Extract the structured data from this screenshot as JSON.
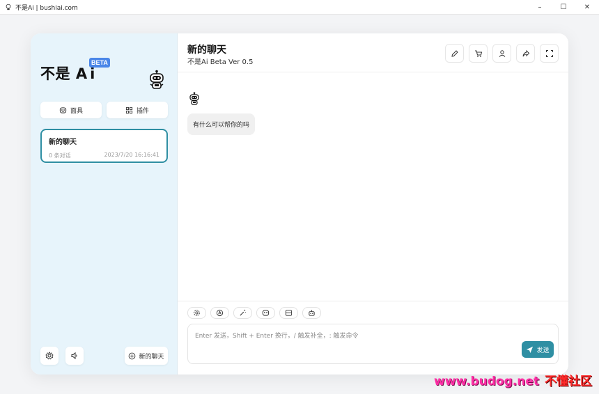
{
  "window": {
    "title": "不是Ai | bushiai.com",
    "controls": [
      "–",
      "☐",
      "✕"
    ]
  },
  "sidebar": {
    "brand": "不是",
    "brand_suffix": "Ai",
    "beta_label": "BETA",
    "mask_button": "面具",
    "plugin_button": "插件",
    "chats": [
      {
        "title": "新的聊天",
        "count": "0 条对话",
        "time": "2023/7/20 16:16:41"
      }
    ],
    "new_chat_button": "新的聊天"
  },
  "header": {
    "title": "新的聊天",
    "subtitle": "不是Ai Beta Ver 0.5"
  },
  "messages": [
    {
      "role": "assistant",
      "text": "有什么可以帮你的吗"
    }
  ],
  "input": {
    "placeholder": "Enter 发送，Shift + Enter 换行，/ 触发补全，: 触发命令",
    "send_label": "发送"
  },
  "watermark": {
    "latin": "www.budog.net",
    "cn": "不懂社区"
  },
  "colors": {
    "accent": "#2f8fa3",
    "sidebar_bg": "#e7f4fb",
    "beta_badge": "#4a86e8"
  }
}
